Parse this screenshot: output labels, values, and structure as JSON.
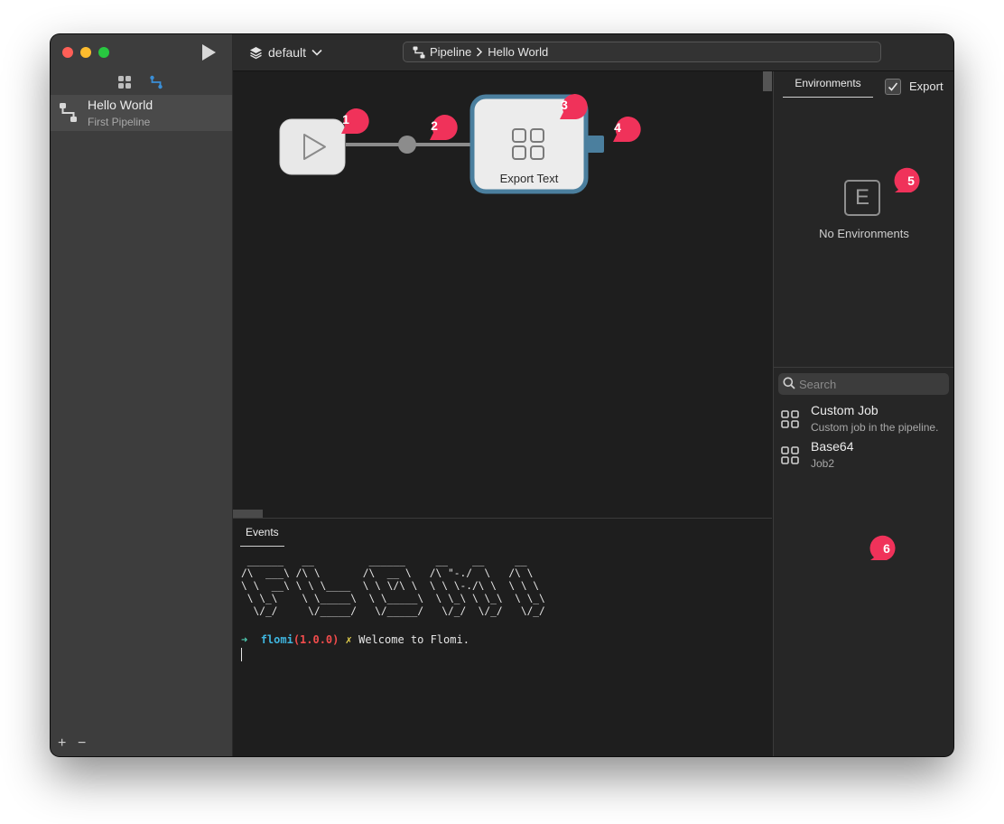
{
  "sidebar": {
    "pipelines": [
      {
        "title": "Hello World",
        "subtitle": "First Pipeline"
      }
    ],
    "add_label": "+",
    "remove_label": "−"
  },
  "toolbar": {
    "environment": "default",
    "breadcrumb": {
      "root": "Pipeline",
      "current": "Hello World"
    }
  },
  "canvas": {
    "nodes": [
      {
        "type": "start",
        "icon": "play-icon"
      },
      {
        "type": "job",
        "label": "Export Text",
        "icon": "grid-icon"
      }
    ],
    "badges": [
      "1",
      "2",
      "3",
      "4",
      "5",
      "6"
    ]
  },
  "events": {
    "tab_label": "Events",
    "ascii_banner": " ______   __         ______     __    __     __    \n/\\  ___\\ /\\ \\       /\\  __ \\   /\\ \"-./  \\   /\\ \\   \n\\ \\  __\\ \\ \\ \\____  \\ \\ \\/\\ \\  \\ \\ \\-./\\ \\  \\ \\ \\  \n \\ \\_\\    \\ \\_____\\  \\ \\_____\\  \\ \\_\\ \\ \\_\\  \\ \\_\\ \n  \\/_/     \\/_____/   \\/_____/   \\/_/  \\/_/   \\/_/ ",
    "prompt": {
      "arrow": "➜",
      "app": "flomi",
      "version": "(1.0.0)",
      "mark": "✗",
      "message": "Welcome to Flomi."
    }
  },
  "right_panel": {
    "tab_label": "Environments",
    "export_label": "Export",
    "export_checked": true,
    "empty_icon_letter": "E",
    "empty_text": "No Environments",
    "search_placeholder": "Search",
    "jobs": [
      {
        "title": "Custom Job",
        "description": "Custom job in the pipeline."
      },
      {
        "title": "Base64",
        "description": "Job2"
      }
    ]
  },
  "colors": {
    "accent_blue": "#3a7fb0",
    "node_border": "#4b7f9e",
    "badge": "#f0325a",
    "prompt_green": "#4ec9b0",
    "prompt_cyan": "#3fb6e0",
    "prompt_red": "#f14c4c",
    "prompt_yellow": "#e8d44d"
  }
}
